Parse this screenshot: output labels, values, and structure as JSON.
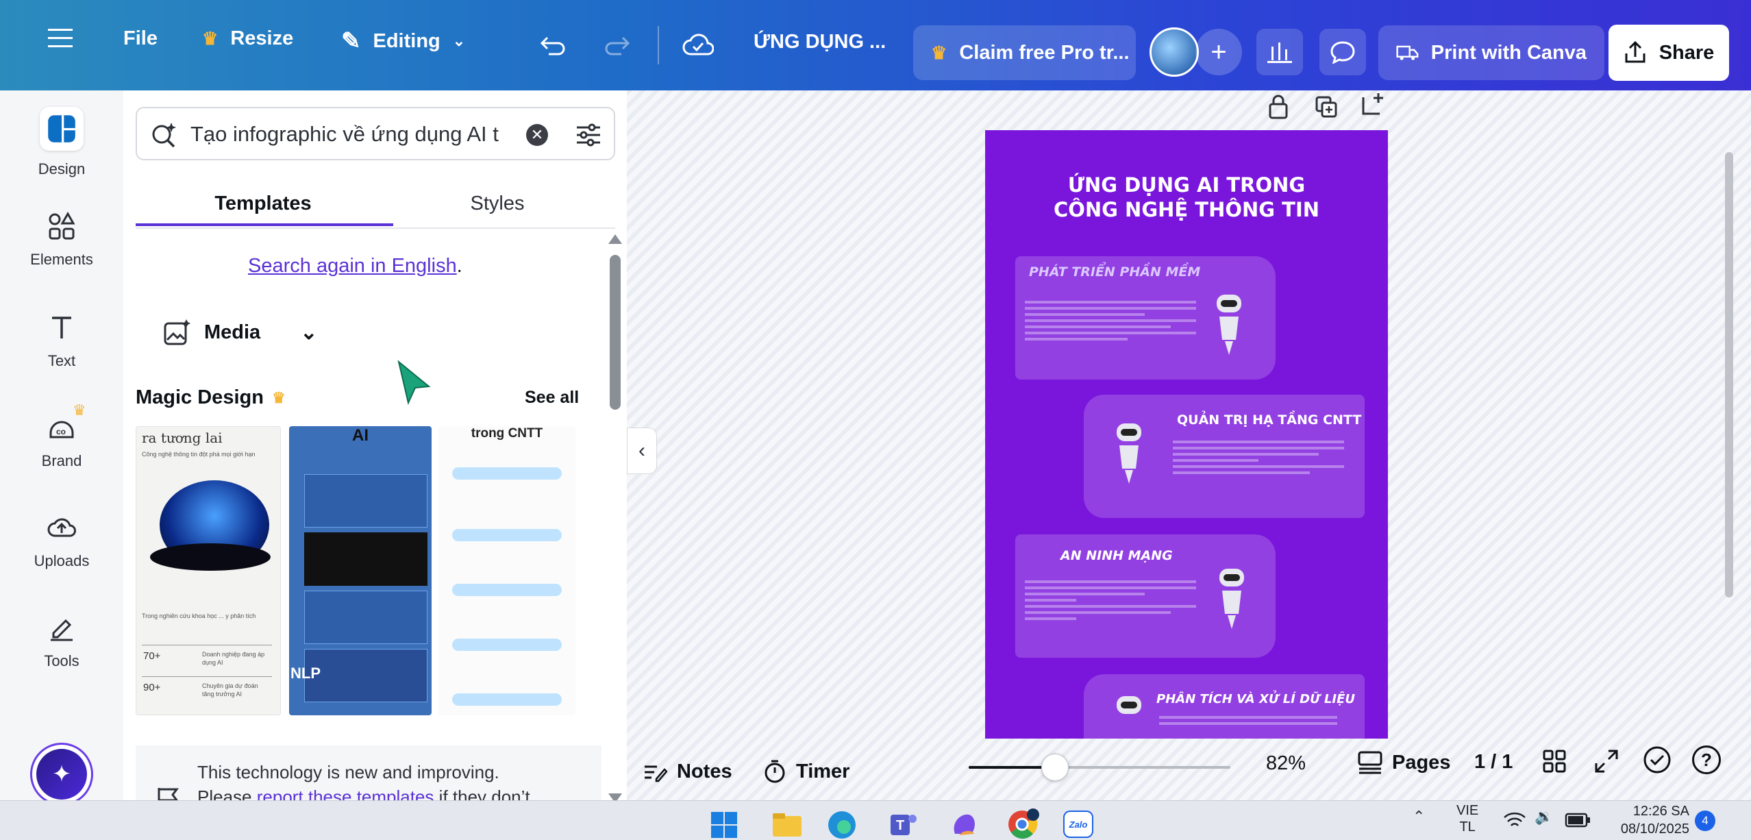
{
  "topbar": {
    "file": "File",
    "resize": "Resize",
    "editing": "Editing",
    "doc_title": "ỨNG DỤNG ...",
    "claim": "Claim free Pro tr...",
    "print": "Print with Canva",
    "share": "Share"
  },
  "rail": {
    "design": "Design",
    "elements": "Elements",
    "text": "Text",
    "brand": "Brand",
    "uploads": "Uploads",
    "tools": "Tools"
  },
  "panel": {
    "search_value": "Tạo infographic về ứng dụng AI t",
    "tab_templates": "Templates",
    "tab_styles": "Styles",
    "search_again": "Search again in English",
    "search_again_suffix": ".",
    "media": "Media",
    "magic_design": "Magic Design",
    "see_all": "See all",
    "notice_line1": "This technology is new and improving.",
    "notice_prefix": "Please ",
    "notice_link": "report these templates",
    "notice_suffix": " if they don’t"
  },
  "thumbs": {
    "t1_title": "ra tương lai",
    "t1_stat1": "70+",
    "t1_stat2": "90+",
    "t2_title": "AI",
    "t2_label": "NLP",
    "t3_title": "trong CNTT"
  },
  "design": {
    "title_line1": "ỨNG DỤNG AI TRONG",
    "title_line2": "CÔNG NGHỆ THÔNG TIN",
    "sections": [
      {
        "title": "PHÁT TRIỂN PHẦN MỀM"
      },
      {
        "title": "QUẢN TRỊ HẠ TẦNG CNTT"
      },
      {
        "title": "AN NINH MẠNG"
      },
      {
        "title": "PHÂN TÍCH VÀ XỬ LÍ DỮ LIỆU"
      }
    ]
  },
  "footer": {
    "notes": "Notes",
    "timer": "Timer",
    "zoom": "82%",
    "zoom_level": 0.82,
    "pages": "Pages",
    "page_count": "1 / 1",
    "help": "?"
  },
  "taskbar": {
    "lang1": "VIE",
    "lang2": "TL",
    "time": "12:26 SA",
    "date": "08/10/2025",
    "badge": "4",
    "zalo": "Zalo"
  },
  "colors": {
    "accent": "#7d2ae8",
    "design_bg": "#7a16dc",
    "link": "#5a32d6"
  }
}
